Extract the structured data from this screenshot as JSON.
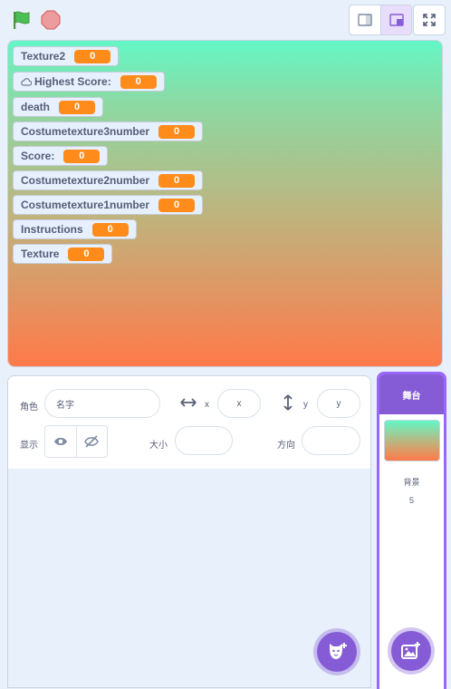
{
  "controls": {
    "green_flag_icon": "green-flag-icon",
    "stop_icon": "stop-sign-icon"
  },
  "stage_modes": [
    "small-stage-icon",
    "normal-stage-icon"
  ],
  "monitors": [
    {
      "label": "Texture2",
      "value": "0"
    },
    {
      "label": "Highest Score:",
      "value": "0",
      "cloud": true
    },
    {
      "label": "death",
      "value": "0"
    },
    {
      "label": "Costumetexture3number",
      "value": "0"
    },
    {
      "label": "Score:",
      "value": "0"
    },
    {
      "label": "Costumetexture2number",
      "value": "0"
    },
    {
      "label": "Costumetexture1number",
      "value": "0"
    },
    {
      "label": "Instructions",
      "value": "0"
    },
    {
      "label": "Texture",
      "value": "0"
    }
  ],
  "sprite_info": {
    "sprite_label": "角色",
    "name_placeholder": "名字",
    "x_label": "x",
    "x_placeholder": "x",
    "y_label": "y",
    "y_placeholder": "y",
    "show_label": "显示",
    "size_label": "大小",
    "direction_label": "方向"
  },
  "stage_selector": {
    "title": "舞台",
    "backdrops_label": "背景",
    "backdrops_count": "5"
  },
  "colors": {
    "accent": "#855cd6",
    "monitor_value": "#ff8c1a"
  }
}
